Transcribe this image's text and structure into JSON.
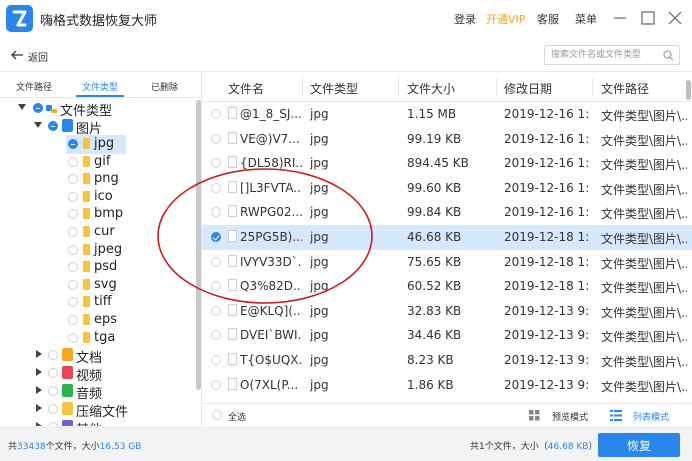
{
  "app": {
    "title": "嗨格式数据恢复大师",
    "login": "登录",
    "vip": "开通VIP",
    "service": "客服",
    "menu": "菜单"
  },
  "nav": {
    "back_label": "返回",
    "search_placeholder": "搜索文件名或文件类型"
  },
  "left_tabs": [
    "文件路径",
    "文件类型",
    "已删除"
  ],
  "active_left_tab": "文件类型",
  "tree": {
    "root": "文件类型",
    "images": "图片",
    "image_types": [
      "jpg",
      "gif",
      "png",
      "ico",
      "bmp",
      "cur",
      "jpeg",
      "psd",
      "svg",
      "tiff",
      "eps",
      "tga"
    ],
    "selected_type": "jpg",
    "others": [
      "文档",
      "视频",
      "音频",
      "压缩文件",
      "其他"
    ]
  },
  "table": {
    "columns": [
      "文件名",
      "文件类型",
      "文件大小",
      "修改日期",
      "文件路径"
    ],
    "rows": [
      {
        "name": "@1_8_SJ...",
        "type": "jpg",
        "size": "1.15 MB",
        "date": "2019-12-16 1:...",
        "path": "文件类型\\图片\\..."
      },
      {
        "name": "VE@)V7...",
        "type": "jpg",
        "size": "99.19 KB",
        "date": "2019-12-16 1:...",
        "path": "文件类型\\图片\\..."
      },
      {
        "name": "{DL58)RI...",
        "type": "jpg",
        "size": "894.45 KB",
        "date": "2019-12-16 1:...",
        "path": "文件类型\\图片\\..."
      },
      {
        "name": "[]L3FVTA...",
        "type": "jpg",
        "size": "99.60 KB",
        "date": "2019-12-16 1:...",
        "path": "文件类型\\图片\\..."
      },
      {
        "name": "RWPG02...",
        "type": "jpg",
        "size": "99.84 KB",
        "date": "2019-12-16 1:...",
        "path": "文件类型\\图片\\..."
      },
      {
        "name": "25PG5B)...",
        "type": "jpg",
        "size": "46.68 KB",
        "date": "2019-12-18 1:...",
        "path": "文件类型\\图片\\...",
        "selected": true
      },
      {
        "name": "IVYV33D`...",
        "type": "jpg",
        "size": "75.65 KB",
        "date": "2019-12-18 1:...",
        "path": "文件类型\\图片\\..."
      },
      {
        "name": "Q3%82D...",
        "type": "jpg",
        "size": "60.52 KB",
        "date": "2019-12-18 1:...",
        "path": "文件类型\\图片\\..."
      },
      {
        "name": "E@KLQ](...",
        "type": "jpg",
        "size": "32.83 KB",
        "date": "2019-12-13 9:...",
        "path": "文件类型\\图片\\..."
      },
      {
        "name": "DVEI`BWI...",
        "type": "jpg",
        "size": "34.46 KB",
        "date": "2019-12-13 9:...",
        "path": "文件类型\\图片\\..."
      },
      {
        "name": "T{O$UQX...",
        "type": "jpg",
        "size": "8.23 KB",
        "date": "2019-12-13 9:...",
        "path": "文件类型\\图片\\..."
      },
      {
        "name": "O(7XL(P...",
        "type": "jpg",
        "size": "1.86 KB",
        "date": "2019-12-13 9:...",
        "path": "文件类型\\图片\\..."
      }
    ]
  },
  "footer": {
    "select_all": "全选",
    "preview_mode": "预览模式",
    "list_mode": "列表模式"
  },
  "status": {
    "total_prefix": "共",
    "total_count": "33438",
    "total_mid": "个文件，大小",
    "total_size": "16.53 GB",
    "selected_prefix": "共",
    "selected_count": "1",
    "selected_mid": "个文件，大小（",
    "selected_size": "46.68 KB",
    "selected_suffix": "）",
    "recover_label": "恢复"
  },
  "colors": {
    "accent": "#2a86e8",
    "vip": "#f5a623",
    "annotation": "#c81e1e"
  }
}
